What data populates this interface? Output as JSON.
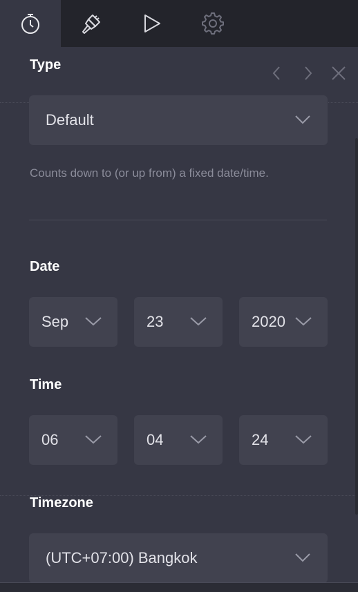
{
  "tabs": [
    {
      "icon": "stopwatch-icon",
      "active": true
    },
    {
      "icon": "paint-brush-icon",
      "active": false
    },
    {
      "icon": "play-icon",
      "active": false
    },
    {
      "icon": "gear-icon",
      "active": false
    }
  ],
  "type": {
    "label": "Type",
    "selected": "Default",
    "description": "Counts down to (or up from) a fixed date/time."
  },
  "date": {
    "label": "Date",
    "month": "Sep",
    "day": "23",
    "year": "2020"
  },
  "time": {
    "label": "Time",
    "hour": "06",
    "minute": "04",
    "second": "24"
  },
  "timezone": {
    "label": "Timezone",
    "selected": "(UTC+07:00) Bangkok"
  },
  "colors": {
    "panel": "#363744",
    "tabbar": "#23242b",
    "field": "#41424f"
  }
}
